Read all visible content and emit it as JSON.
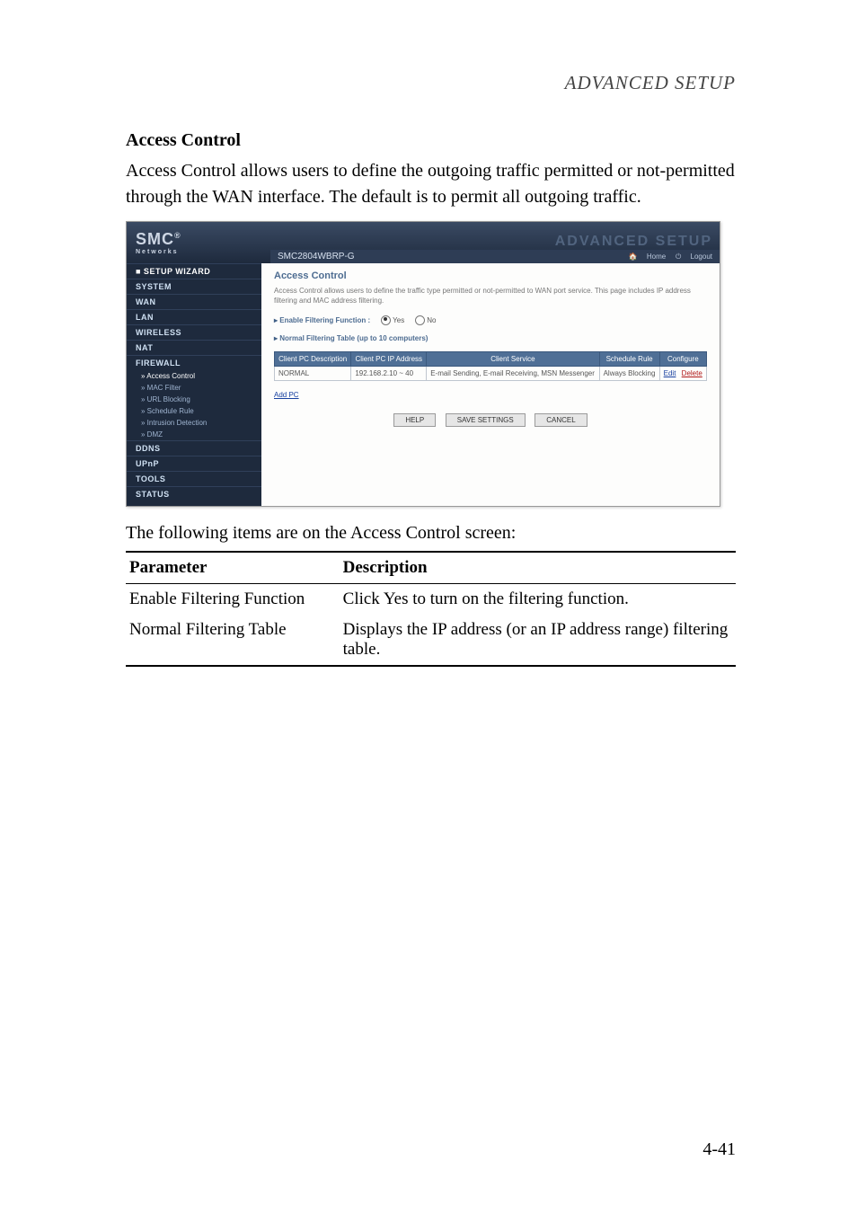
{
  "header": "ADVANCED SETUP",
  "section_title": "Access Control",
  "paragraph": "Access Control allows users to define the outgoing traffic permitted or not-permitted through the WAN interface. The default is to permit all outgoing traffic.",
  "caption": "The following items are on the Access Control screen:",
  "param_table": {
    "head_param": "Parameter",
    "head_desc": "Description",
    "rows": [
      {
        "param": "Enable Filtering Function",
        "desc": "Click Yes to turn on the filtering function."
      },
      {
        "param": "Normal Filtering Table",
        "desc": "Displays the IP address (or an IP address range) filtering table."
      }
    ]
  },
  "page_number": "4-41",
  "shot": {
    "logo_main": "SMC",
    "logo_sub": "Networks",
    "adv_text": "ADVANCED SETUP",
    "model": "SMC2804WBRP-G",
    "home": "Home",
    "logout": "Logout",
    "nav": {
      "setup": "■ SETUP WIZARD",
      "items": [
        "SYSTEM",
        "WAN",
        "LAN",
        "WIRELESS",
        "NAT",
        "FIREWALL"
      ],
      "fw_subs": [
        "» Access Control",
        "» MAC Filter",
        "» URL Blocking",
        "» Schedule Rule",
        "» Intrusion Detection",
        "» DMZ"
      ],
      "rest": [
        "DDNS",
        "UPnP",
        "TOOLS",
        "STATUS"
      ]
    },
    "content": {
      "title": "Access Control",
      "desc": "Access Control allows users to define the traffic type permitted or not-permitted to WAN port service. This page includes IP address filtering and MAC address filtering.",
      "enable_label": "Enable Filtering Function :",
      "yes": "Yes",
      "no": "No",
      "table_label": "Normal Filtering Table (up to 10 computers)",
      "thead": {
        "desc": "Client PC Description",
        "ip": "Client PC IP Address",
        "service": "Client Service",
        "rule": "Schedule Rule",
        "conf": "Configure"
      },
      "row": {
        "desc": "NORMAL",
        "ip": "192.168.2.10 ~ 40",
        "service": "E-mail Sending, E-mail Receiving, MSN Messenger",
        "rule": "Always Blocking",
        "edit": "Edit",
        "del": "Delete"
      },
      "addpc": "Add PC",
      "btn_help": "HELP",
      "btn_save": "SAVE SETTINGS",
      "btn_cancel": "CANCEL"
    }
  }
}
